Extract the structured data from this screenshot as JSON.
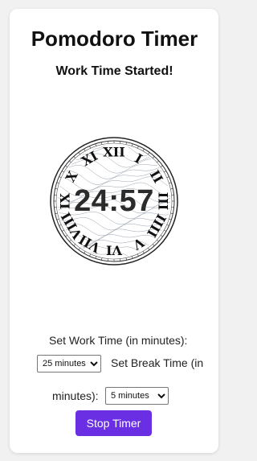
{
  "app": {
    "title": "Pomodoro Timer",
    "status": "Work Time Started!"
  },
  "timer": {
    "display": "24:57",
    "numerals": [
      "XII",
      "I",
      "II",
      "III",
      "IIII",
      "V",
      "VI",
      "VII",
      "VIII",
      "IX",
      "X",
      "XI"
    ]
  },
  "settings": {
    "work_label": "Set Work Time (in minutes):",
    "work_selected": "25 minutes",
    "break_label_line1": "Set Break Time (in",
    "break_label_line2": "minutes):",
    "break_selected": "5 minutes"
  },
  "controls": {
    "stop_label": "Stop Timer"
  },
  "colors": {
    "accent": "#6a2fe3",
    "card": "#ffffff",
    "background": "#f1f1f1"
  },
  "icons": {
    "clock_face": "clock-face-icon"
  }
}
